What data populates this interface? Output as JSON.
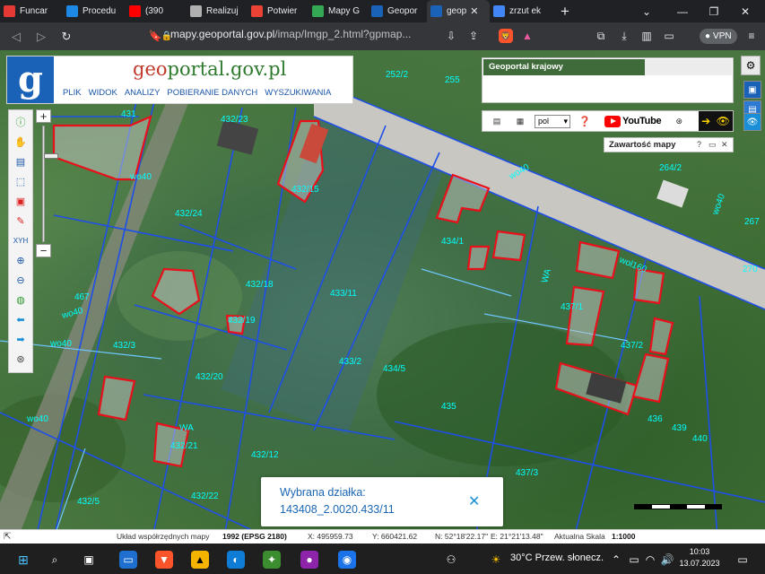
{
  "browser": {
    "tabs": [
      {
        "title": "Funcar",
        "icon": "form-icon",
        "color": "#e53935"
      },
      {
        "title": "Procedu",
        "icon": "chrome-icon",
        "color": "#1e88e5"
      },
      {
        "title": "(390",
        "icon": "youtube-icon",
        "color": "#ff0000"
      },
      {
        "title": "Realizuj",
        "icon": "settings-icon",
        "color": "#b0b0b0"
      },
      {
        "title": "Potwier",
        "icon": "gmail-icon",
        "color": "#ea4335"
      },
      {
        "title": "Mapy G",
        "icon": "maps-pin-icon",
        "color": "#34a853"
      },
      {
        "title": "Geopor",
        "icon": "geoportal-icon",
        "color": "#1a62b8"
      },
      {
        "title": "geop",
        "icon": "geoportal-icon",
        "color": "#1a62b8",
        "active": true
      },
      {
        "title": "zrzut ek",
        "icon": "google-icon",
        "color": "#4285f4"
      }
    ],
    "address": {
      "host": "mapy.geoportal.gov.pl",
      "path": "/imap/Imgp_2.html?gpmap..."
    },
    "vpn_label": "VPN"
  },
  "geoportal": {
    "logo_letter": "g",
    "title_a": "geo",
    "title_b": "portal.gov.pl",
    "menu": [
      "PLIK",
      "WIDOK",
      "ANALIZY",
      "POBIERANIE DANYCH",
      "WYSZUKIWANIA"
    ],
    "krajowy_title": "Geoportal krajowy",
    "language": "pol",
    "youtube_label": "YouTube",
    "contents_label": "Zawartość mapy",
    "contents_help": "?"
  },
  "map_labels": [
    {
      "text": "252/2"
    },
    {
      "text": "255"
    },
    {
      "text": "431"
    },
    {
      "text": "432/23"
    },
    {
      "text": "432/15"
    },
    {
      "text": "432/24"
    },
    {
      "text": "432/18"
    },
    {
      "text": "432/19"
    },
    {
      "text": "433/11"
    },
    {
      "text": "433/2"
    },
    {
      "text": "434/5"
    },
    {
      "text": "434/1"
    },
    {
      "text": "432/20"
    },
    {
      "text": "432/3"
    },
    {
      "text": "432/21"
    },
    {
      "text": "432/12"
    },
    {
      "text": "432/22"
    },
    {
      "text": "432/5"
    },
    {
      "text": "437/1"
    },
    {
      "text": "437/2"
    },
    {
      "text": "437/3"
    },
    {
      "text": "435"
    },
    {
      "text": "436"
    },
    {
      "text": "439"
    },
    {
      "text": "440"
    },
    {
      "text": "264/2"
    },
    {
      "text": "267"
    },
    {
      "text": "270"
    },
    {
      "text": "467"
    },
    {
      "text": "wol160"
    },
    {
      "text": "wo40"
    },
    {
      "text": "wo40"
    },
    {
      "text": "wo40"
    },
    {
      "text": "wo40"
    },
    {
      "text": "wo40"
    },
    {
      "text": "wo40"
    },
    {
      "text": "WA"
    },
    {
      "text": "WA"
    }
  ],
  "popup": {
    "label": "Wybrana działka:",
    "value": "143408_2.0020.433/11"
  },
  "statusbar": {
    "crs_label": "Układ współrzędnych mapy",
    "crs_value": "1992 (EPSG 2180)",
    "x": "X: 495959.73",
    "y": "Y: 660421.62",
    "n": "N: 52°18'22.17\"",
    "e": "E: 21°21'13.48\"",
    "scale_label": "Aktualna Skala",
    "scale_value": "1:1000"
  },
  "taskbar": {
    "weather": "30°C  Przew. słonecz.",
    "time": "10:03",
    "date": "13.07.2023"
  }
}
